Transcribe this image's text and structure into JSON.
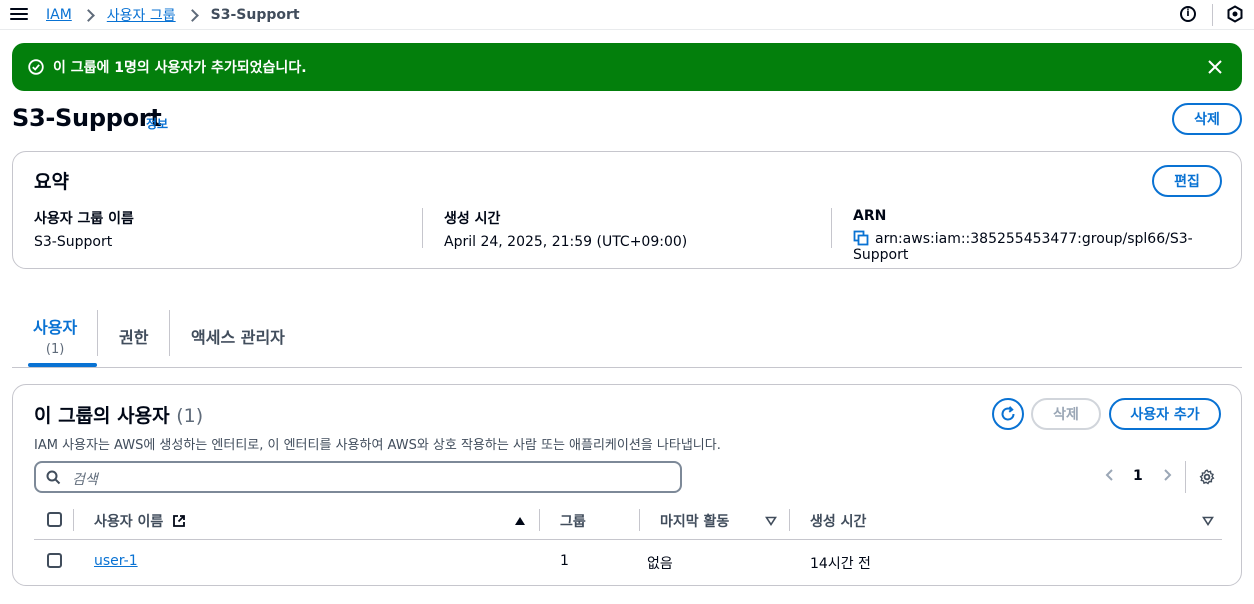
{
  "breadcrumbs": [
    {
      "label": "IAM"
    },
    {
      "label": "사용자 그룹"
    },
    {
      "label": "S3-Support"
    }
  ],
  "flash": {
    "message": "이 그룹에 1명의 사용자가 추가되었습니다.",
    "type": "success",
    "color": "#037f0c"
  },
  "header": {
    "title": "S3-Support",
    "info_label": "정보",
    "delete_label": "삭제"
  },
  "summary": {
    "title": "요약",
    "edit_label": "편집",
    "fields": [
      {
        "label": "사용자 그룹 이름",
        "value": "S3-Support"
      },
      {
        "label": "생성 시간",
        "value": "April 24, 2025, 21:59 (UTC+09:00)"
      },
      {
        "label": "ARN",
        "value": "arn:aws:iam::385255453477:group/spl66/S3-Support"
      }
    ]
  },
  "tabs": [
    {
      "label": "사용자",
      "count": "(1)",
      "active": true
    },
    {
      "label": "권한"
    },
    {
      "label": "액세스 관리자"
    }
  ],
  "users_panel": {
    "title": "이 그룹의 사용자",
    "count": "(1)",
    "description": "IAM 사용자는 AWS에 생성하는 엔터티로, 이 엔터티를 사용하여 AWS와 상호 작용하는 사람 또는 애플리케이션을 나타냅니다.",
    "delete_label": "삭제",
    "add_label": "사용자 추가",
    "search_placeholder": "검색",
    "current_page": "1",
    "columns": [
      "사용자 이름",
      "그룹",
      "마지막 활동",
      "생성 시간"
    ],
    "rows": [
      {
        "name": "user-1",
        "groups": "1",
        "last_activity": "없음",
        "created": "14시간 전"
      }
    ]
  },
  "colors": {
    "accent": "#0972d3",
    "success": "#037f0c",
    "text": "#000716",
    "border": "#c6c6cd"
  }
}
